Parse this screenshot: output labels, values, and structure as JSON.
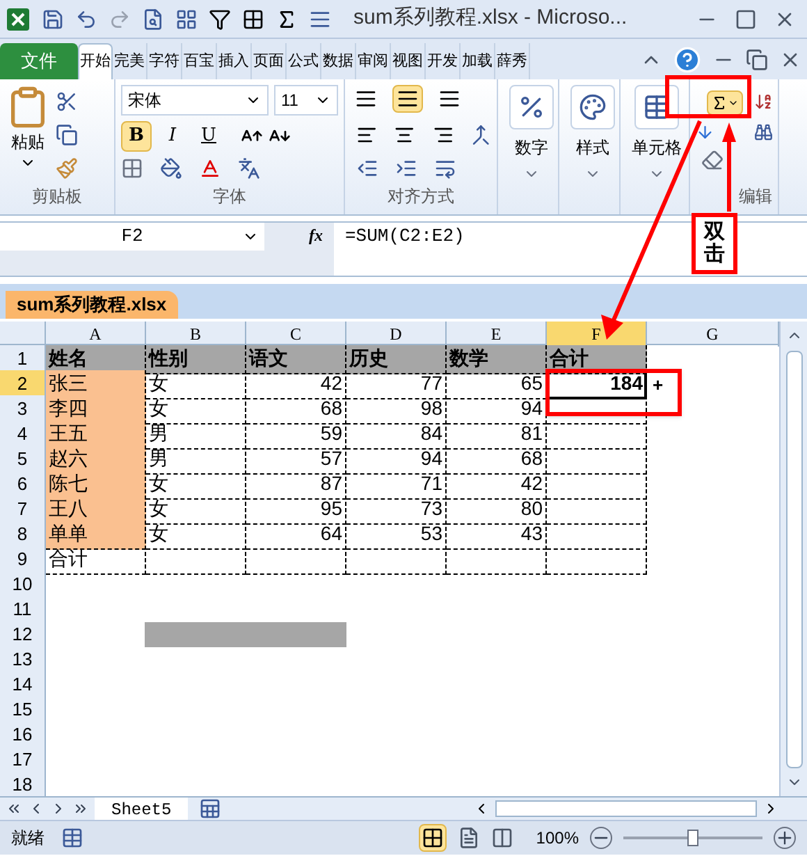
{
  "window": {
    "title": "sum系列教程.xlsx  -  Microso..."
  },
  "ribbon_tabs": [
    {
      "label": "文件",
      "kind": "file",
      "selected": false
    },
    {
      "label": "开始",
      "kind": "tab",
      "selected": true
    },
    {
      "label": "完美",
      "kind": "tab",
      "selected": false
    },
    {
      "label": "字符",
      "kind": "tab",
      "selected": false
    },
    {
      "label": "百宝",
      "kind": "tab",
      "selected": false
    },
    {
      "label": "插入",
      "kind": "tab",
      "selected": false
    },
    {
      "label": "页面",
      "kind": "tab",
      "selected": false
    },
    {
      "label": "公式",
      "kind": "tab",
      "selected": false
    },
    {
      "label": "数据",
      "kind": "tab",
      "selected": false
    },
    {
      "label": "审阅",
      "kind": "tab",
      "selected": false
    },
    {
      "label": "视图",
      "kind": "tab",
      "selected": false
    },
    {
      "label": "开发",
      "kind": "tab",
      "selected": false
    },
    {
      "label": "加载",
      "kind": "tab",
      "selected": false
    },
    {
      "label": "薛秀",
      "kind": "tab",
      "selected": false
    }
  ],
  "clipboard": {
    "paste": "粘贴",
    "group": "剪贴板"
  },
  "font": {
    "name": "宋体",
    "size": "11",
    "group": "字体",
    "styles": [
      {
        "label": "B",
        "kind": "bold",
        "selected": true
      },
      {
        "label": "I",
        "kind": "italic",
        "selected": false
      },
      {
        "label": "U",
        "kind": "underline",
        "selected": false
      }
    ]
  },
  "alignment": {
    "group": "对齐方式",
    "vertical": [
      {
        "selected": false
      },
      {
        "selected": true
      },
      {
        "selected": false
      }
    ]
  },
  "number": {
    "label": "数字"
  },
  "styles": {
    "label": "样式"
  },
  "cells": {
    "label": "单元格"
  },
  "editing": {
    "group": "编辑",
    "autosum_selected": true
  },
  "formula_bar": {
    "name_box": "F2",
    "fx": "fx",
    "formula": "=SUM(C2:E2)"
  },
  "workbook_tab": "sum系列教程.xlsx",
  "sheet": {
    "columns": [
      {
        "label": "A",
        "selected": false
      },
      {
        "label": "B",
        "selected": false
      },
      {
        "label": "C",
        "selected": false
      },
      {
        "label": "D",
        "selected": false
      },
      {
        "label": "E",
        "selected": false
      },
      {
        "label": "F",
        "selected": true
      },
      {
        "label": "G",
        "selected": false
      }
    ],
    "rows": [
      {
        "number": "1",
        "selected": false,
        "cells": [
          "姓名",
          "性别",
          "语文",
          "历史",
          "数学",
          "合计"
        ]
      },
      {
        "number": "2",
        "selected": true,
        "cells": [
          "张三",
          "女",
          "42",
          "77",
          "65",
          "184"
        ]
      },
      {
        "number": "3",
        "selected": false,
        "cells": [
          "李四",
          "女",
          "68",
          "98",
          "94",
          ""
        ]
      },
      {
        "number": "4",
        "selected": false,
        "cells": [
          "王五",
          "男",
          "59",
          "84",
          "81",
          ""
        ]
      },
      {
        "number": "5",
        "selected": false,
        "cells": [
          "赵六",
          "男",
          "57",
          "94",
          "68",
          ""
        ]
      },
      {
        "number": "6",
        "selected": false,
        "cells": [
          "陈七",
          "女",
          "87",
          "71",
          "42",
          ""
        ]
      },
      {
        "number": "7",
        "selected": false,
        "cells": [
          "王八",
          "女",
          "95",
          "73",
          "80",
          ""
        ]
      },
      {
        "number": "8",
        "selected": false,
        "cells": [
          "单单",
          "女",
          "64",
          "53",
          "43",
          ""
        ]
      },
      {
        "number": "9",
        "selected": false,
        "cells": [
          "合计",
          "",
          "",
          "",
          "",
          ""
        ]
      },
      {
        "number": "10",
        "selected": false
      },
      {
        "number": "11",
        "selected": false
      },
      {
        "number": "12",
        "selected": false
      },
      {
        "number": "13",
        "selected": false
      },
      {
        "number": "14",
        "selected": false
      },
      {
        "number": "15",
        "selected": false
      },
      {
        "number": "16",
        "selected": false
      },
      {
        "number": "17",
        "selected": false
      },
      {
        "number": "18",
        "selected": false
      }
    ]
  },
  "cursor": "+",
  "sheet_tabs": [
    {
      "label": "Sheet5",
      "selected": true
    }
  ],
  "status_bar": {
    "status": "就绪",
    "zoom": "100%",
    "level": 0.5
  },
  "annotation": {
    "label": "双击"
  }
}
